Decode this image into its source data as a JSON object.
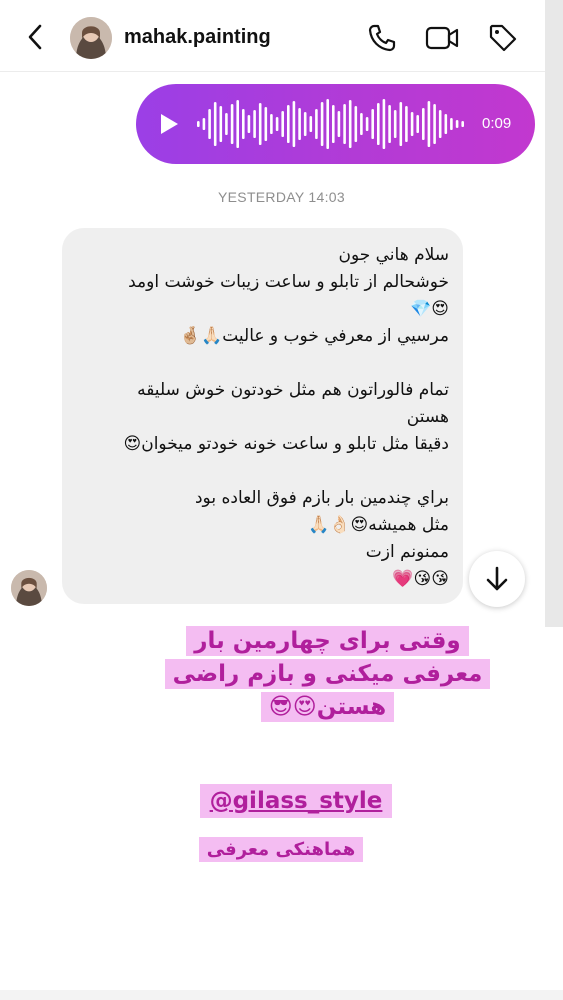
{
  "header": {
    "username": "mahak.painting",
    "icons": [
      "back-arrow-icon",
      "phone-icon",
      "video-camera-icon",
      "tag-icon"
    ]
  },
  "voice_message": {
    "duration": "0:09",
    "color": "#b23bd6"
  },
  "timestamp": "YESTERDAY 14:03",
  "message": {
    "lines": [
      "سلام هاني جون",
      "خوشحالم از تابلو و ساعت زيبات خوشت اومد",
      "😍💎",
      "مرسيي از معرفي خوب و عاليت🙏🏻🤞🏼",
      "",
      "تمام فالوراتون هم مثل خودتون خوش سليقه",
      "هستن",
      "دقيقا مثل تابلو و ساعت خونه خودتو ميخوان😍",
      "",
      "براي چندمين بار بازم فوق العاده بود",
      "مثل هميشه😍👌🏻🙏🏻",
      "ممنونم ازت",
      "😘😘💗"
    ]
  },
  "story_overlay": {
    "caption_lines": [
      "وقتی برای چهارمین بار",
      "معرفی میکنی و بازم راضی",
      "هستن😍😎"
    ],
    "mention": "@gilass_style",
    "subtitle": "هماهنکی معرفی",
    "text_color": "#b01f9c",
    "highlight_color": "#f4bdf2"
  }
}
